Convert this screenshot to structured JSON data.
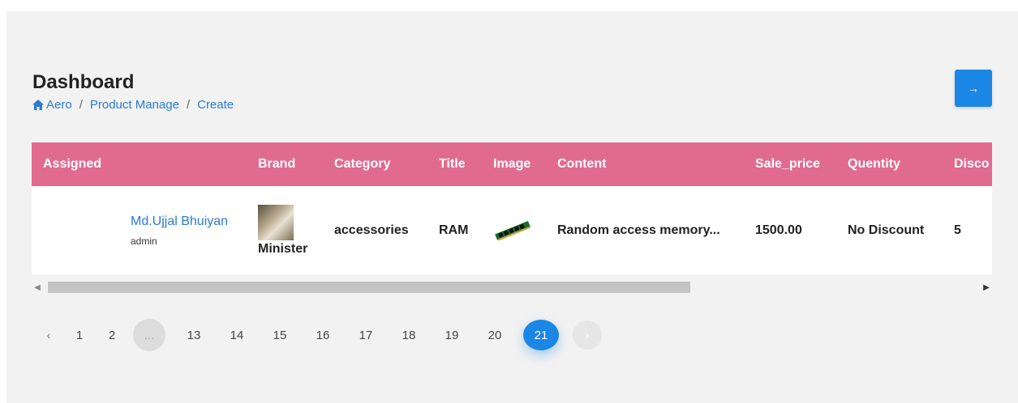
{
  "header": {
    "title": "Dashboard",
    "breadcrumb": [
      "Aero",
      "Product Manage",
      "Create"
    ],
    "nav_button_icon": "arrow-right-icon"
  },
  "table": {
    "columns": [
      "Assigned",
      "Brand",
      "Category",
      "Title",
      "Image",
      "Content",
      "Sale_price",
      "Quentity",
      "Disco"
    ],
    "rows": [
      {
        "assigned_name": "Md.Ujjal Bhuiyan",
        "assigned_role": "admin",
        "brand": "Minister",
        "category": "accessories",
        "title": "RAM",
        "image": "ram-module-image",
        "content": "Random access memory...",
        "sale_price": "1500.00",
        "quentity": "No Discount",
        "discount": "5"
      }
    ]
  },
  "pagination": {
    "prev": "‹",
    "pages": [
      "1",
      "2",
      "...",
      "13",
      "14",
      "15",
      "16",
      "17",
      "18",
      "19",
      "20",
      "21"
    ],
    "active": "21",
    "next": "›"
  },
  "colors": {
    "header_row": "#e06b8e",
    "accent": "#1a86e6",
    "link": "#2b7bd0"
  }
}
